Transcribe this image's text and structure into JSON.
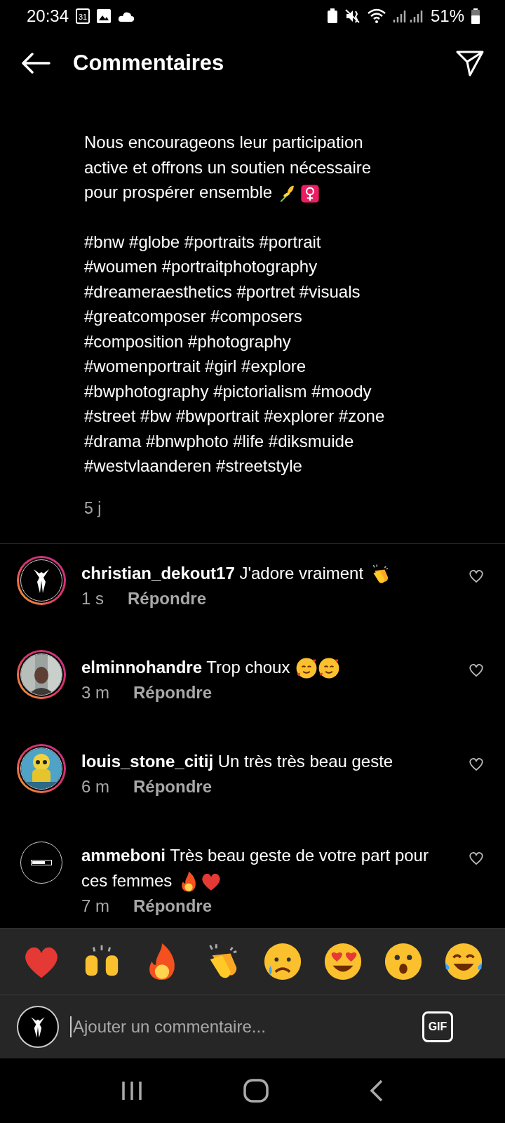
{
  "status_bar": {
    "time": "20:34",
    "calendar_day": "31",
    "battery": "51%"
  },
  "header": {
    "title": "Commentaires"
  },
  "caption": {
    "paragraphs": [
      {
        "lines": [
          "Nous encourageons leur participation",
          "active et offrons un soutien nécessaire",
          "pour prospérer ensemble"
        ],
        "emojis": [
          {
            "kind": "sheaf"
          },
          {
            "kind": "female-sign"
          }
        ]
      },
      {
        "lines": [
          "#bnw #globe #portraits #portrait",
          "#woumen #portraitphotography",
          "#dreameraesthetics #portret #visuals",
          "#greatcomposer #composers",
          "#composition #photography",
          "#womenportrait #girl #explore",
          "#bwphotography #pictorialism #moody",
          "#street #bw #bwportrait #explorer #zone",
          "#drama #bnwphoto #life #diksmuide",
          "#westvlaanderen #streetstyle"
        ]
      }
    ],
    "time": "5 j"
  },
  "comments": [
    {
      "username": "christian_dekout17",
      "text": "J'adore vraiment",
      "emojis": [
        {
          "kind": "clap"
        }
      ],
      "time": "1 s",
      "reply": "Répondre",
      "story": true,
      "avatar": {
        "kind": "tuxedo"
      }
    },
    {
      "username": "elminnohandre",
      "text": "Trop choux",
      "emojis": [
        {
          "kind": "smiling-hearts"
        },
        {
          "kind": "smiling-hearts"
        }
      ],
      "time": "3 m",
      "reply": "Répondre",
      "story": true,
      "avatar": {
        "kind": "picture"
      }
    },
    {
      "username": "louis_stone_citij",
      "text": "Un très très beau geste",
      "time": "6 m",
      "reply": "Répondre",
      "story": true,
      "avatar": {
        "kind": "picture"
      }
    },
    {
      "username": "ammeboni",
      "text": "Très beau geste de votre part pour ces femmes",
      "emojis": [
        {
          "kind": "fire"
        },
        {
          "kind": "heart"
        }
      ],
      "time": "7 m",
      "reply": "Répondre",
      "story": false,
      "avatar": {
        "kind": "loading"
      }
    }
  ],
  "reactions": [
    {
      "kind": "heart"
    },
    {
      "kind": "raised-hands"
    },
    {
      "kind": "fire"
    },
    {
      "kind": "clap"
    },
    {
      "kind": "crying"
    },
    {
      "kind": "heart-eyes"
    },
    {
      "kind": "surprised"
    },
    {
      "kind": "laughing"
    }
  ],
  "composer": {
    "placeholder": "Ajouter un commentaire...",
    "gif": "GIF"
  }
}
